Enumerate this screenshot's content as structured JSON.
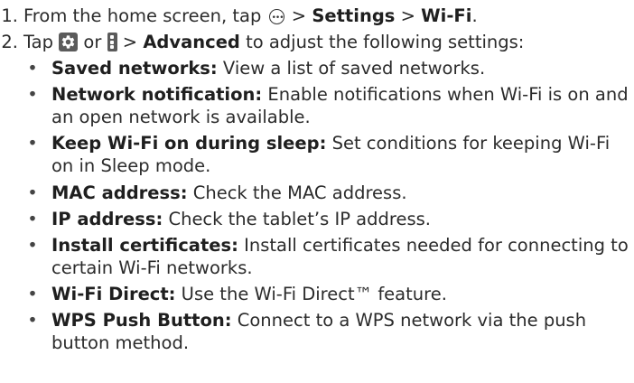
{
  "step1": {
    "num": "1.",
    "text_a": "From the home screen, tap",
    "apps_icon": "apps-icon",
    "sep1": " > ",
    "bold1": "Settings",
    "sep2": " > ",
    "bold2": "Wi-Fi",
    "end": "."
  },
  "step2": {
    "num": "2.",
    "text_a": "Tap",
    "gear_icon": "gear-icon",
    "or": " or ",
    "menu_icon": "menu-icon",
    "sep": " > ",
    "bold": "Advanced",
    "rest": " to adjust the following settings:"
  },
  "bullets": [
    {
      "term": "Saved networks:",
      "desc": " View a list of saved networks."
    },
    {
      "term": "Network notification:",
      "desc": " Enable notifications when Wi-Fi is on and an open network is available."
    },
    {
      "term": "Keep Wi-Fi on during sleep:",
      "desc": " Set conditions for keeping Wi-Fi on in Sleep mode."
    },
    {
      "term": "MAC address:",
      "desc": " Check the MAC address."
    },
    {
      "term": "IP address:",
      "desc": " Check the tablet’s IP address."
    },
    {
      "term": "Install certificates:",
      "desc": " Install certificates needed for connecting to certain Wi-Fi networks."
    },
    {
      "term": "Wi-Fi Direct:",
      "desc": " Use the Wi-Fi Direct™ feature."
    },
    {
      "term": "WPS Push Button:",
      "desc": " Connect to a WPS network via the push button method."
    }
  ],
  "bullet_char": "•"
}
